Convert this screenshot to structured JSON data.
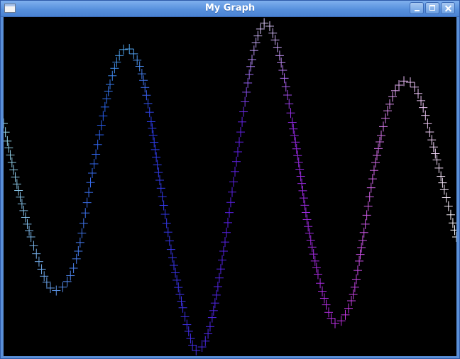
{
  "window": {
    "title": "My Graph",
    "controls": {
      "minimize_icon": "minimize-icon",
      "maximize_icon": "maximize-icon",
      "close_icon": "close-icon"
    }
  },
  "chart_data": {
    "type": "scatter",
    "marker": "plus",
    "background": "#000000",
    "color_gradient": [
      "#9ad8e6",
      "#1a4cf0",
      "#5a20e8",
      "#c030e0",
      "#ffffff"
    ],
    "x": [
      0,
      0.05,
      0.1,
      0.15,
      0.2,
      0.25,
      0.3,
      0.35,
      0.4,
      0.45,
      0.5,
      0.55,
      0.6,
      0.65,
      0.7,
      0.75,
      0.8,
      0.85,
      0.9,
      0.95,
      1.0
    ],
    "y_profile": "damped_oscillation"
  }
}
